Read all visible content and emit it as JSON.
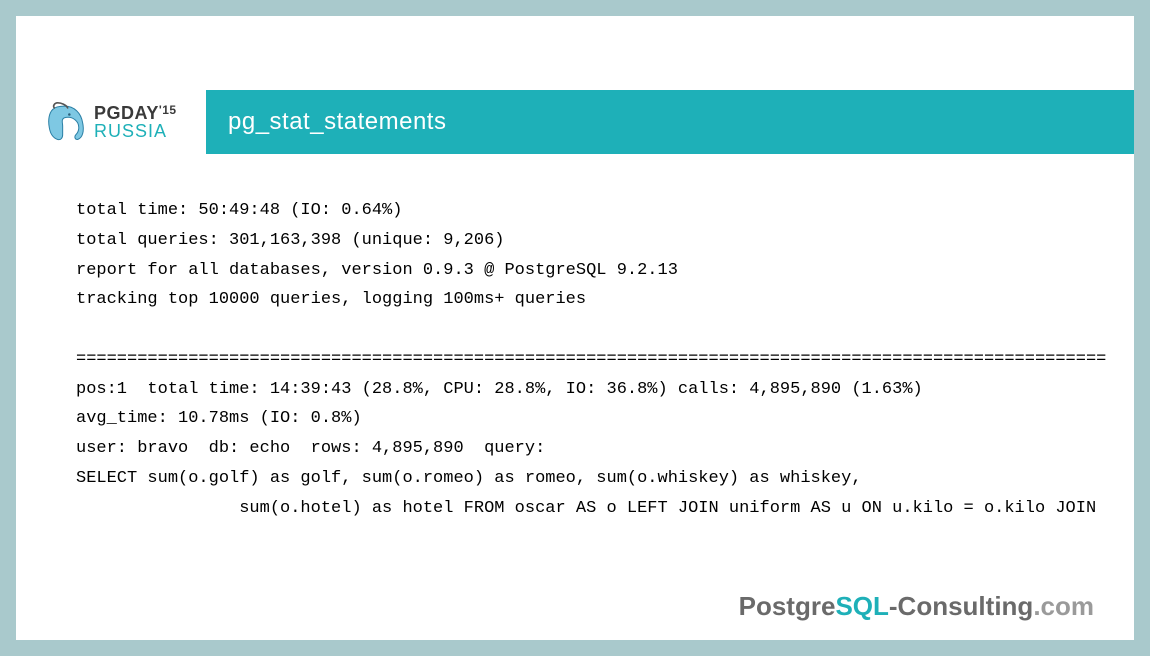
{
  "logo": {
    "top": "PGDAY",
    "year": "'15",
    "bottom": "RUSSIA"
  },
  "title": "pg_stat_statements",
  "report": {
    "line1": "total time: 50:49:48 (IO: 0.64%)",
    "line2": "total queries: 301,163,398 (unique: 9,206)",
    "line3": "report for all databases, version 0.9.3 @ PostgreSQL 9.2.13",
    "line4": "tracking top 10000 queries, logging 100ms+ queries",
    "sep": "=====================================================================================================",
    "line5": "pos:1  total time: 14:39:43 (28.8%, CPU: 28.8%, IO: 36.8%) calls: 4,895,890 (1.63%)",
    "line6": "avg_time: 10.78ms (IO: 0.8%)",
    "line7": "user: bravo  db: echo  rows: 4,895,890  query:",
    "line8": "SELECT sum(o.golf) as golf, sum(o.romeo) as romeo, sum(o.whiskey) as whiskey,",
    "line9": "                sum(o.hotel) as hotel FROM oscar AS o LEFT JOIN uniform AS u ON u.kilo = o.kilo JOIN "
  },
  "footer": {
    "p1": "Postgre",
    "p2": "SQL",
    "p3": "-Consulting",
    "p4": ".com"
  }
}
